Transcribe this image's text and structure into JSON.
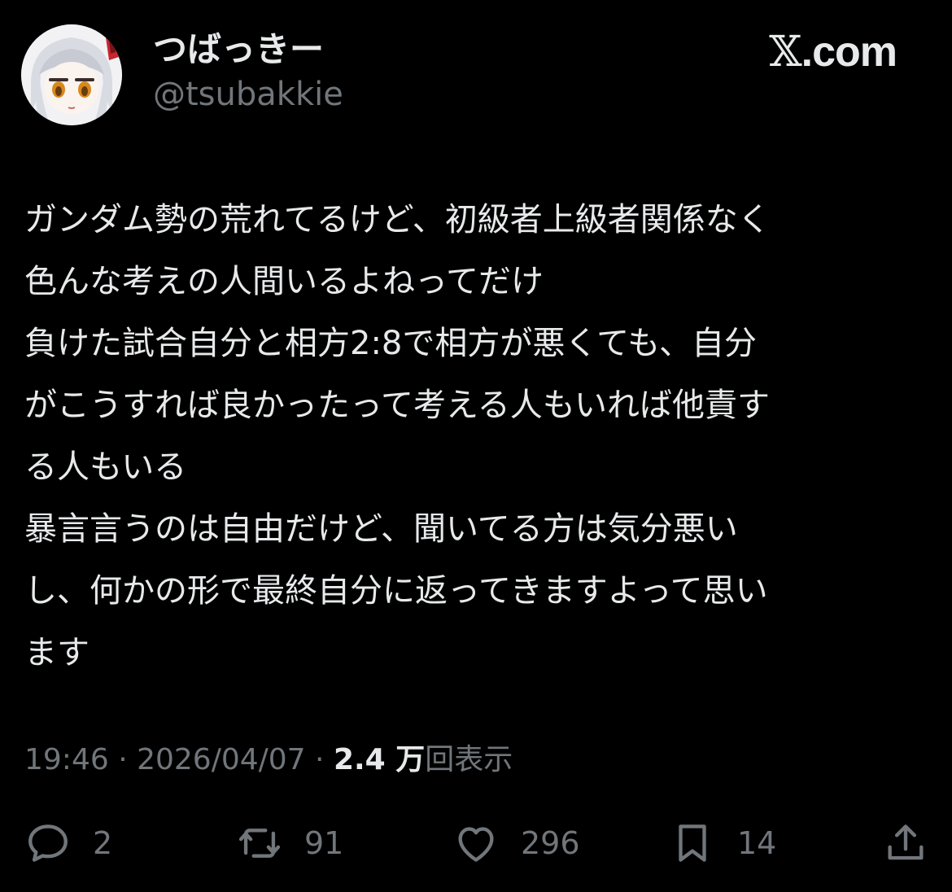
{
  "header": {
    "display_name": "つばっきー",
    "handle": "@tsubakkie",
    "brand": ".com",
    "brand_mark": "𝕏"
  },
  "tweet": {
    "lines": [
      "ガンダム勢の荒れてるけど、初級者上級者関係なく",
      "色んな考えの人間いるよねってだけ",
      "負けた試合自分と相方2:8で相方が悪くても、自分",
      "がこうすれば良かったって考える人もいれば他責す",
      "る人もいる",
      "暴言言うのは自由だけど、聞いてる方は気分悪い",
      "し、何かの形で最終自分に返ってきますよって思い",
      "ます"
    ]
  },
  "meta": {
    "time": "19:46",
    "separator": " · ",
    "date": "2026/04/07",
    "views_count": "2.4 万",
    "views_label": "回表示"
  },
  "actions": {
    "reply_count": "2",
    "repost_count": "91",
    "like_count": "296",
    "bookmark_count": "14"
  },
  "colors": {
    "background": "#000000",
    "text_primary": "#e7e9ea",
    "text_secondary": "#71767b"
  },
  "icons": {
    "reply": "speech-bubble-icon",
    "repost": "repost-arrows-icon",
    "like": "heart-icon",
    "bookmark": "bookmark-icon",
    "share": "share-upload-icon"
  }
}
